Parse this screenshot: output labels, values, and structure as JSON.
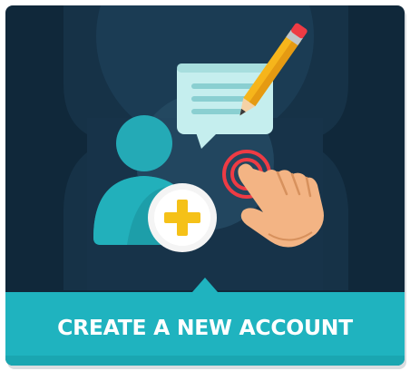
{
  "banner": {
    "label": "CREATE A NEW ACCOUNT"
  },
  "icons": {
    "user": "user-silhouette-icon",
    "add": "plus-badge-icon",
    "message": "speech-bubble-icon",
    "pencil": "pencil-icon",
    "hand": "tap-hand-icon",
    "ripple": "touch-ripple-icon"
  },
  "colors": {
    "background": "#10283a",
    "panel": "#1a3b52",
    "teal": "#1fb3bf",
    "teal_dark": "#17979f",
    "yellow": "#f5c118",
    "bubble": "#b7e8e8",
    "red": "#ee3b44",
    "skin": "#f3b484",
    "pencil": "#f9b21d"
  }
}
